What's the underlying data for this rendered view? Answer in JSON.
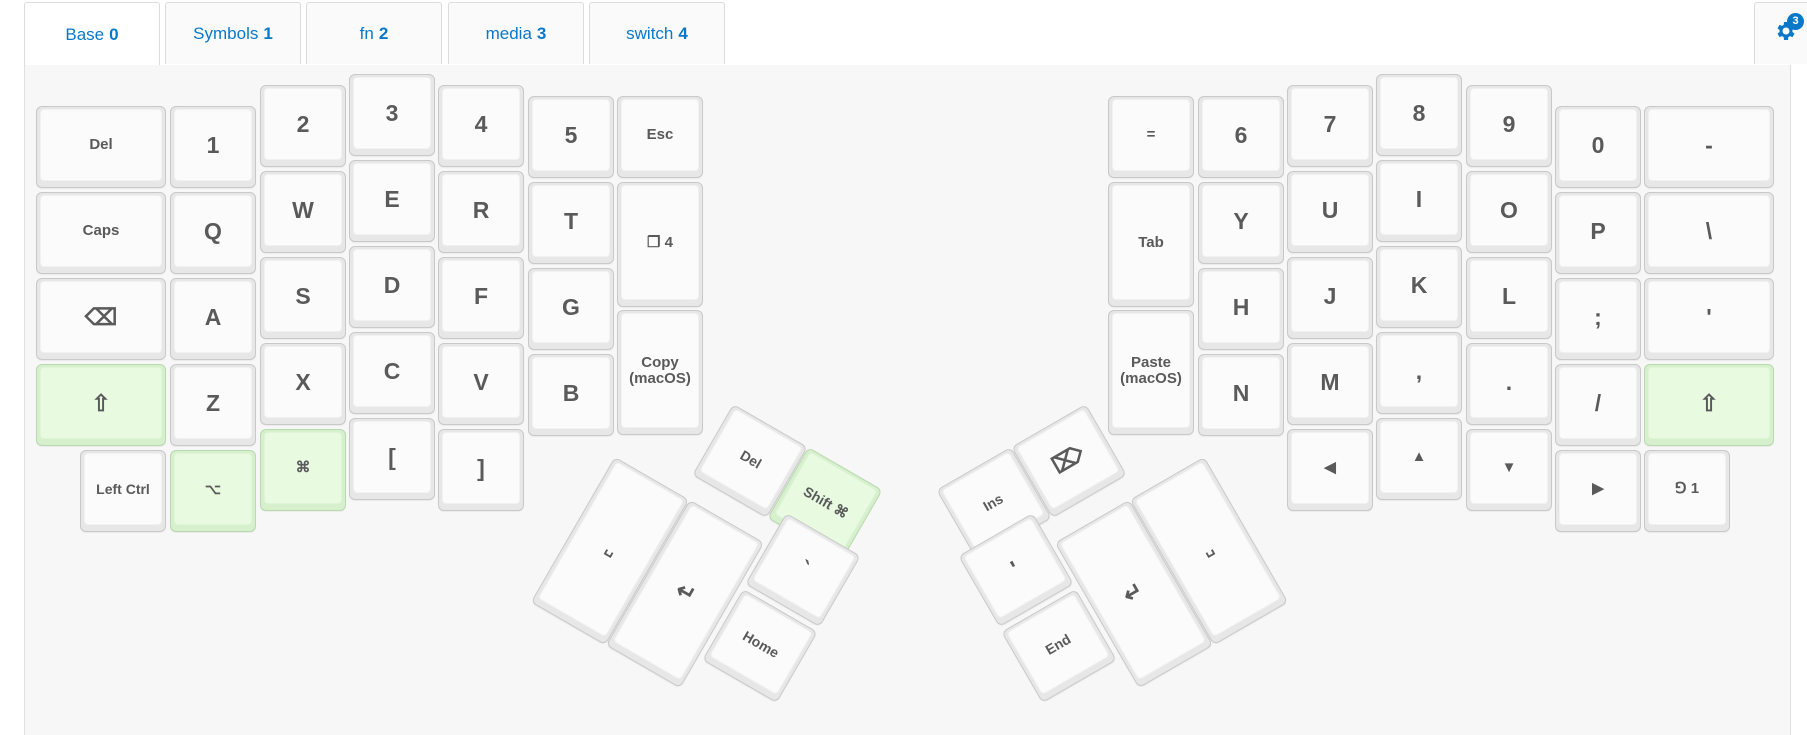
{
  "tabs": [
    {
      "label": "Base",
      "num": "0"
    },
    {
      "label": "Symbols",
      "num": "1"
    },
    {
      "label": "fn",
      "num": "2"
    },
    {
      "label": "media",
      "num": "3"
    },
    {
      "label": "switch",
      "num": "4"
    }
  ],
  "settings": {
    "badge": "3",
    "icon": "gear-icon"
  },
  "colors": {
    "accent": "#0a78c9",
    "modifier_key": "#e8fbe1",
    "key": "#fbfbfb"
  },
  "keys": {
    "del_left": "Del",
    "k1": "1",
    "k2": "2",
    "k3": "3",
    "k4": "4",
    "k5": "5",
    "esc": "Esc",
    "caps": "Caps",
    "q": "Q",
    "w": "W",
    "e": "E",
    "r": "R",
    "t": "T",
    "layer4": "❐ 4",
    "backspace_icon": "⌫",
    "a": "A",
    "s": "S",
    "d": "D",
    "f": "F",
    "g": "G",
    "copy": "Copy (macOS)",
    "shift_left": "⇧",
    "z": "Z",
    "x": "X",
    "c": "C",
    "v": "V",
    "b": "B",
    "left_ctrl": "Left Ctrl",
    "option": "⌥",
    "cmd": "⌘",
    "lbracket": "[",
    "rbracket": "]",
    "thumb_del": "Del",
    "thumb_shift_cmd": "Shift ⌘",
    "thumb_space_left": "␣",
    "thumb_enter_left": "↵",
    "thumb_grave": "`",
    "thumb_home": "Home",
    "equals": "=",
    "k6": "6",
    "k7": "7",
    "k8": "8",
    "k9": "9",
    "k0": "0",
    "minus": "-",
    "tab": "Tab",
    "y": "Y",
    "u": "U",
    "i": "I",
    "o": "O",
    "p": "P",
    "backslash": "\\",
    "paste": "Paste (macOS)",
    "h": "H",
    "j": "J",
    "k": "K",
    "l": "L",
    "semicolon": ";",
    "quote": "'",
    "n": "N",
    "m": "M",
    "comma": ",",
    "period": ".",
    "slash": "/",
    "shift_right": "⇧",
    "arrow_left": "◀",
    "arrow_up": "▲",
    "arrow_down": "▼",
    "arrow_right": "▶",
    "layer1": "⅁ 1",
    "thumb_ins": "Ins",
    "thumb_delete_icon": "⌦",
    "thumb_quote": "'",
    "thumb_enter_right": "↵",
    "thumb_space_right": "␣",
    "thumb_end": "End"
  }
}
